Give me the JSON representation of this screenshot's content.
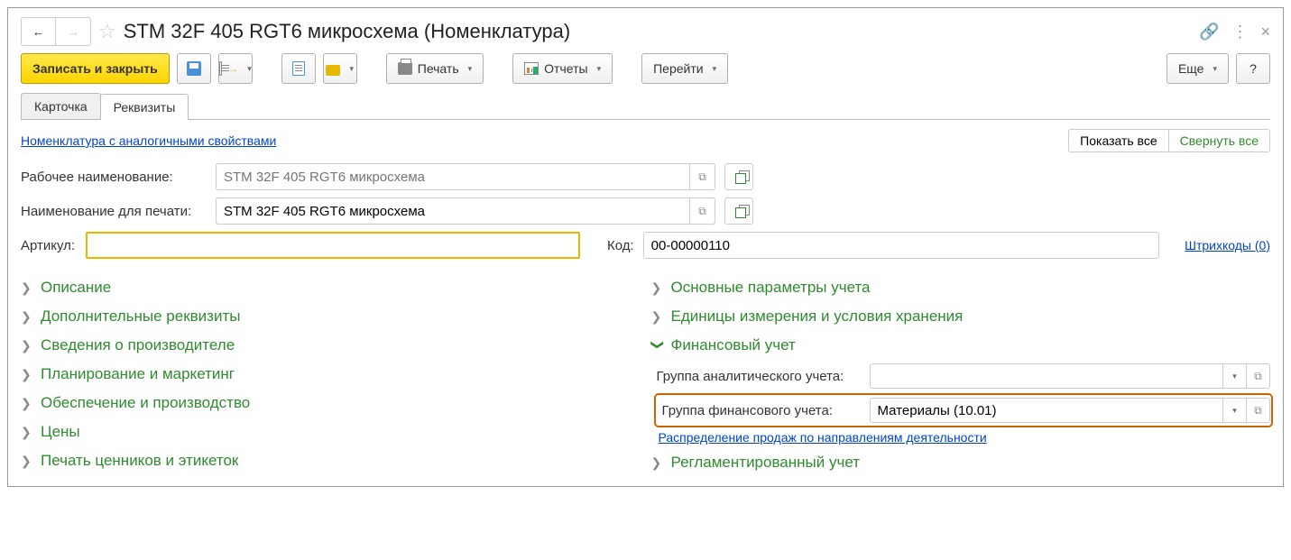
{
  "header": {
    "title": "STM 32F 405 RGT6 микросхема (Номенклатура)"
  },
  "toolbar": {
    "save_close": "Записать и закрыть",
    "print": "Печать",
    "reports": "Отчеты",
    "goto": "Перейти",
    "more": "Еще",
    "help": "?"
  },
  "tabs": {
    "card": "Карточка",
    "details": "Реквизиты"
  },
  "panel": {
    "similar_link": "Номенклатура с аналогичными свойствами",
    "show_all": "Показать все",
    "collapse_all": "Свернуть все"
  },
  "fields": {
    "work_name_label": "Рабочее наименование:",
    "work_name_placeholder": "STM 32F 405 RGT6 микросхема",
    "print_name_label": "Наименование для печати:",
    "print_name_value": "STM 32F 405 RGT6 микросхема",
    "article_label": "Артикул:",
    "article_value": "",
    "code_label": "Код:",
    "code_value": "00-00000110",
    "barcodes_link": "Штрихкоды (0)"
  },
  "groups_left": [
    "Описание",
    "Дополнительные реквизиты",
    "Сведения о производителе",
    "Планирование и маркетинг",
    "Обеспечение и производство",
    "Цены",
    "Печать ценников и этикеток"
  ],
  "groups_right": {
    "main_params": "Основные параметры учета",
    "units": "Единицы измерения и условия хранения",
    "fin": "Финансовый учет",
    "analytic_group_label": "Группа аналитического учета:",
    "analytic_group_value": "",
    "fin_group_label": "Группа финансового учета:",
    "fin_group_value": "Материалы (10.01)",
    "distribution_link": "Распределение продаж по направлениям деятельности",
    "regulated": "Регламентированный учет"
  }
}
